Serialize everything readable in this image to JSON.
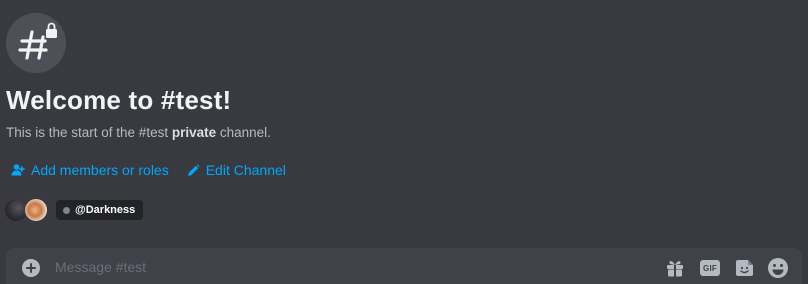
{
  "channel": {
    "icon": "private-text-channel-icon",
    "welcome_title": "Welcome to #test!",
    "description_prefix": "This is the start of the #test ",
    "description_bold": "private",
    "description_suffix": " channel."
  },
  "actions": {
    "add_members_label": "Add members or roles",
    "add_members_icon": "add-member-icon",
    "edit_channel_label": "Edit Channel",
    "edit_channel_icon": "pencil-icon"
  },
  "members": {
    "avatars": [
      "avatar-1",
      "avatar-2"
    ],
    "mention_label": "@Darkness"
  },
  "composer": {
    "placeholder": "Message #test",
    "add_icon": "plus-circle-icon",
    "gift_icon": "gift-icon",
    "gif_label": "GIF",
    "sticker_icon": "sticker-icon",
    "emoji_icon": "emoji-icon"
  },
  "colors": {
    "background": "#383a40",
    "link": "#00a8fc",
    "composer_bg": "#404249",
    "title": "#f2f3f5",
    "muted": "#b5bac1"
  }
}
